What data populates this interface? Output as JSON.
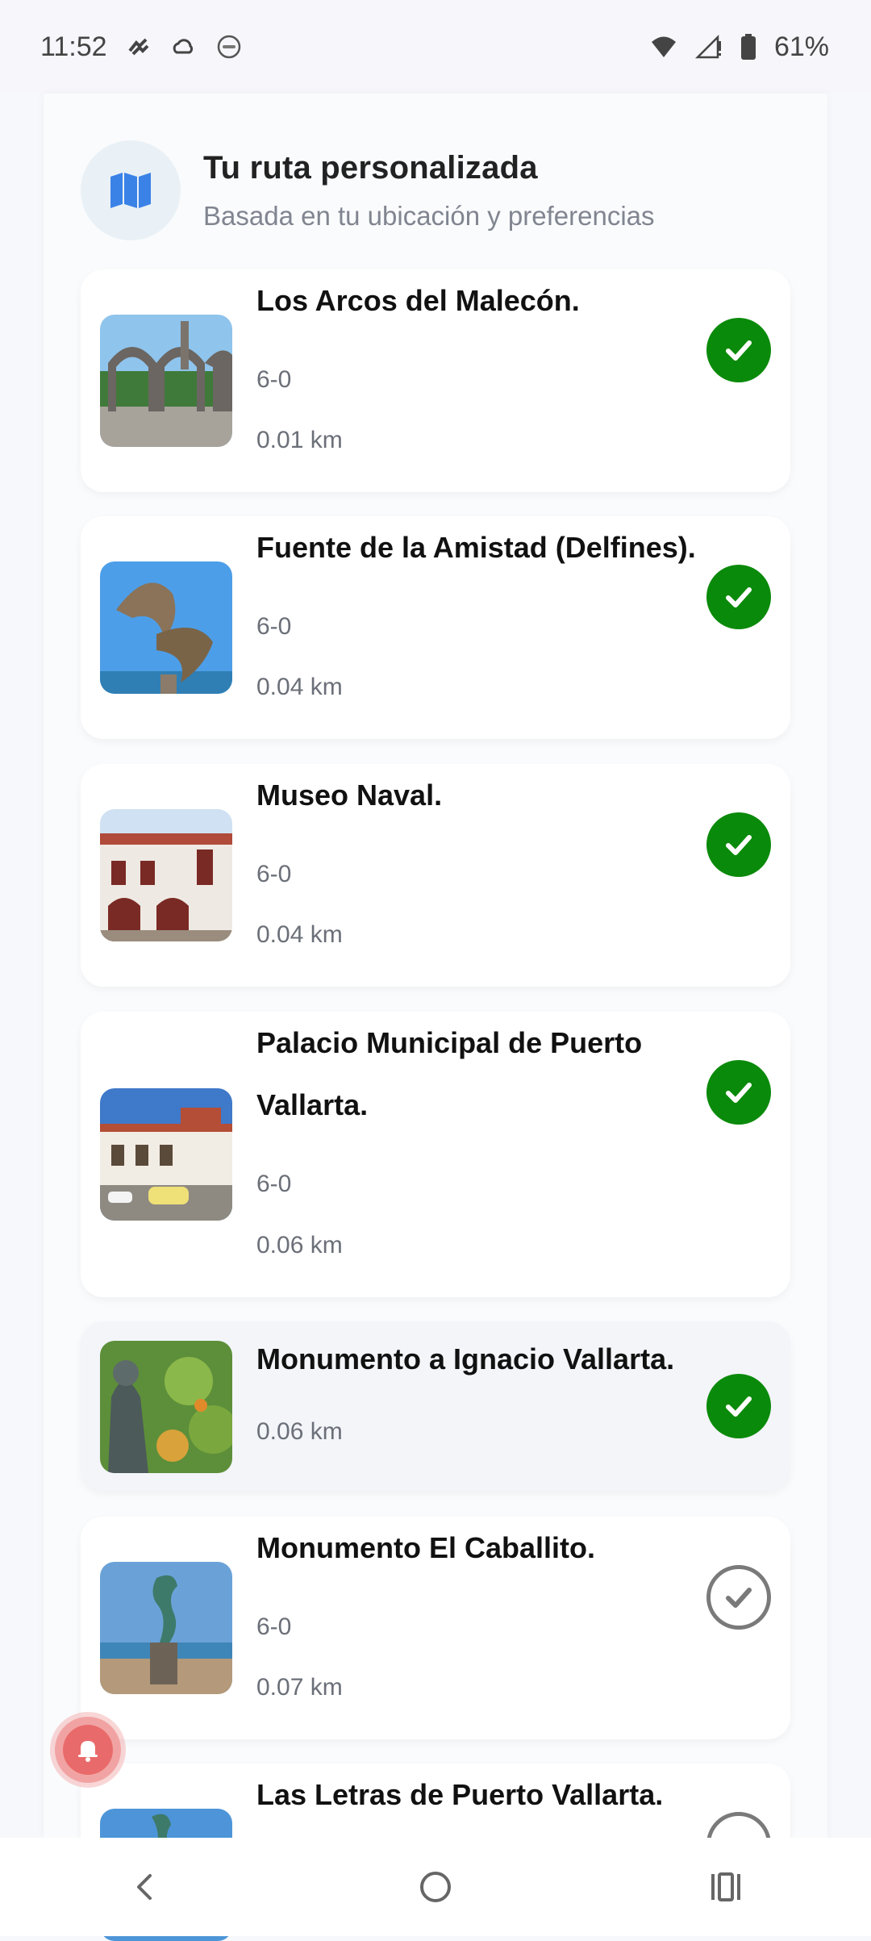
{
  "status_bar": {
    "time": "11:52",
    "battery": "61%",
    "icons": [
      "notification-icon",
      "cloud-icon",
      "circle-badge-icon",
      "wifi-icon",
      "signal-icon",
      "battery-icon"
    ]
  },
  "header": {
    "title": "Tu ruta personalizada",
    "subtitle": "Basada en tu ubicación y preferencias",
    "icon": "map-icon"
  },
  "places": [
    {
      "name": "Los Arcos del Malecón.",
      "hours": "6-0",
      "distance": "0.01 km",
      "visited": true
    },
    {
      "name": "Fuente de la Amistad (Delfines).",
      "hours": "6-0",
      "distance": "0.04 km",
      "visited": true
    },
    {
      "name": "Museo Naval.",
      "hours": "6-0",
      "distance": "0.04 km",
      "visited": true
    },
    {
      "name": "Palacio Municipal de Puerto Vallarta.",
      "hours": "6-0",
      "distance": "0.06 km",
      "visited": true
    },
    {
      "name": "Monumento a Ignacio Vallarta.",
      "distance": "0.06 km",
      "visited": true
    },
    {
      "name": "Monumento El Caballito.",
      "hours": "6-0",
      "distance": "0.07 km",
      "visited": false
    },
    {
      "name": "Las Letras de Puerto Vallarta.",
      "visited": false
    }
  ],
  "colors": {
    "check_done": "#0a8a0a",
    "check_todo": "#7a7a7a",
    "map_icon": "#3b82e6",
    "bell": "#e96a6a"
  },
  "navbar": {
    "icons": [
      "back-icon",
      "home-icon",
      "recents-icon"
    ]
  }
}
